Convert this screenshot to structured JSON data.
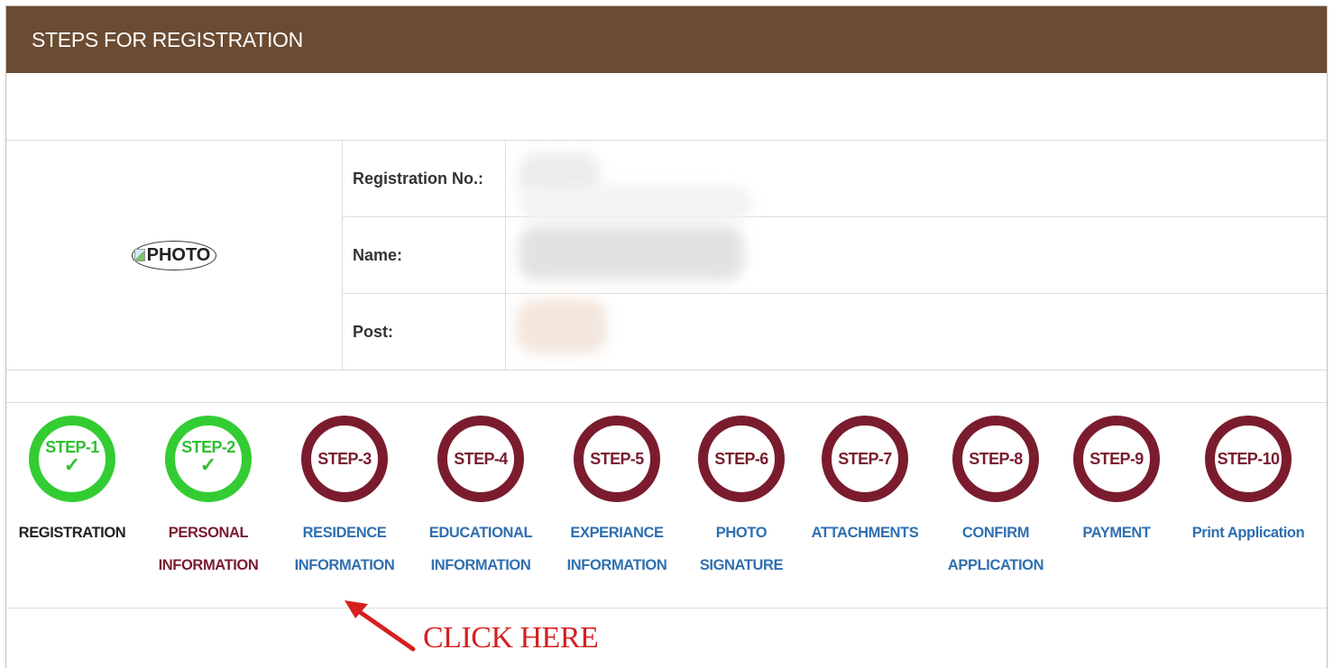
{
  "header": {
    "title": "STEPS FOR REGISTRATION"
  },
  "photo": {
    "alt_text": "PHOTO"
  },
  "details": [
    {
      "label": "Registration No.:"
    },
    {
      "label": "Name:"
    },
    {
      "label": "Post:"
    }
  ],
  "steps": [
    {
      "circle": "STEP-1",
      "line1": "REGISTRATION",
      "line2": "",
      "status": "complete",
      "text_color": "#222222"
    },
    {
      "circle": "STEP-2",
      "line1": "PERSONAL",
      "line2": "INFORMATION",
      "status": "complete",
      "text_color": "#7a1c2e"
    },
    {
      "circle": "STEP-3",
      "line1": "RESIDENCE",
      "line2": "INFORMATION",
      "status": "pending",
      "text_color": "#2f6fb0"
    },
    {
      "circle": "STEP-4",
      "line1": "EDUCATIONAL",
      "line2": "INFORMATION",
      "status": "pending",
      "text_color": "#2f6fb0"
    },
    {
      "circle": "STEP-5",
      "line1": "EXPERIANCE",
      "line2": "INFORMATION",
      "status": "pending",
      "text_color": "#2f6fb0"
    },
    {
      "circle": "STEP-6",
      "line1": "PHOTO",
      "line2": "SIGNATURE",
      "status": "pending",
      "text_color": "#2f6fb0"
    },
    {
      "circle": "STEP-7",
      "line1": "ATTACHMENTS",
      "line2": "",
      "status": "pending",
      "text_color": "#2f6fb0"
    },
    {
      "circle": "STEP-8",
      "line1": "CONFIRM",
      "line2": "APPLICATION",
      "status": "pending",
      "text_color": "#2f6fb0"
    },
    {
      "circle": "STEP-9",
      "line1": "PAYMENT",
      "line2": "",
      "status": "pending",
      "text_color": "#2f6fb0"
    },
    {
      "circle": "STEP-10",
      "line1": "Print Application",
      "line2": "",
      "status": "pending",
      "text_color": "#2f6fb0"
    }
  ],
  "annotation": {
    "text": "CLICK HERE",
    "color": "#d61f1f"
  },
  "colors": {
    "header_bg": "#6b4b32",
    "complete": "#33cc33",
    "pending": "#7a1c2e",
    "link": "#2f6fb0"
  }
}
